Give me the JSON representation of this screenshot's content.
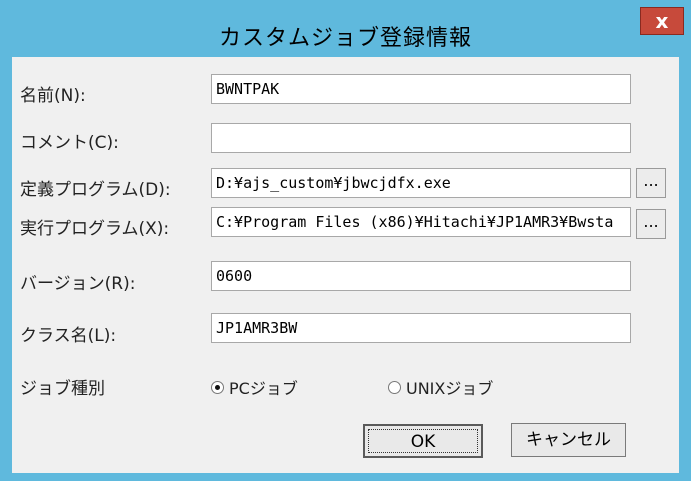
{
  "window": {
    "title": "カスタムジョブ登録情報",
    "close_glyph": "x"
  },
  "fields": {
    "name": {
      "label": "名前(N):",
      "value": "BWNTPAK"
    },
    "comment": {
      "label": "コメント(C):",
      "value": ""
    },
    "def_program": {
      "label": "定義プログラム(D):",
      "value": "D:¥ajs_custom¥jbwcjdfx.exe"
    },
    "exec_program": {
      "label": "実行プログラム(X):",
      "value": "C:¥Program Files (x86)¥Hitachi¥JP1AMR3¥Bwsta"
    },
    "version": {
      "label": "バージョン(R):",
      "value": "0600"
    },
    "class_name": {
      "label": "クラス名(L):",
      "value": "JP1AMR3BW"
    }
  },
  "browse_label": "...",
  "job_type": {
    "label": "ジョブ種別",
    "options": [
      {
        "label": "PCジョブ",
        "selected": true
      },
      {
        "label": "UNIXジョブ",
        "selected": false
      }
    ]
  },
  "buttons": {
    "ok": "OK",
    "cancel": "キャンセル"
  }
}
